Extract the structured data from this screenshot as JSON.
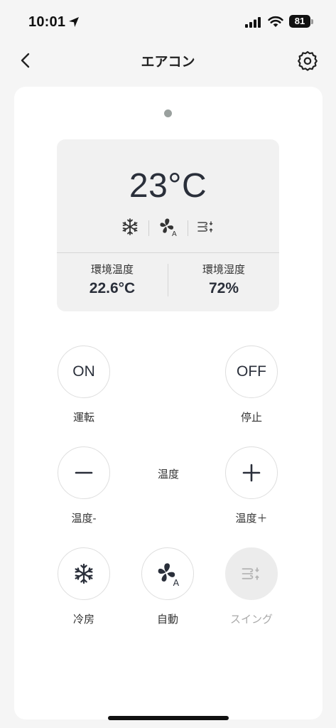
{
  "status_bar": {
    "time": "10:01",
    "battery": "81"
  },
  "nav": {
    "title": "エアコン"
  },
  "panel": {
    "temperature": "23°C",
    "mode_icons": [
      "snowflake-icon",
      "fan-auto-icon",
      "swing-icon"
    ],
    "ambient_temp_label": "環境温度",
    "ambient_temp_value": "22.6°C",
    "ambient_humidity_label": "環境湿度",
    "ambient_humidity_value": "72%"
  },
  "controls": {
    "on_button": "ON",
    "on_label": "運転",
    "off_button": "OFF",
    "off_label": "停止",
    "temp_center_label": "温度",
    "temp_down_label": "温度-",
    "temp_up_label": "温度＋",
    "cool_label": "冷房",
    "auto_label": "自動",
    "swing_label": "スイング"
  },
  "colors": {
    "accent": "#2a2f3a",
    "background": "#f5f5f5",
    "card": "#ffffff",
    "panel": "#f1f1f1",
    "disabled": "#ececec"
  }
}
